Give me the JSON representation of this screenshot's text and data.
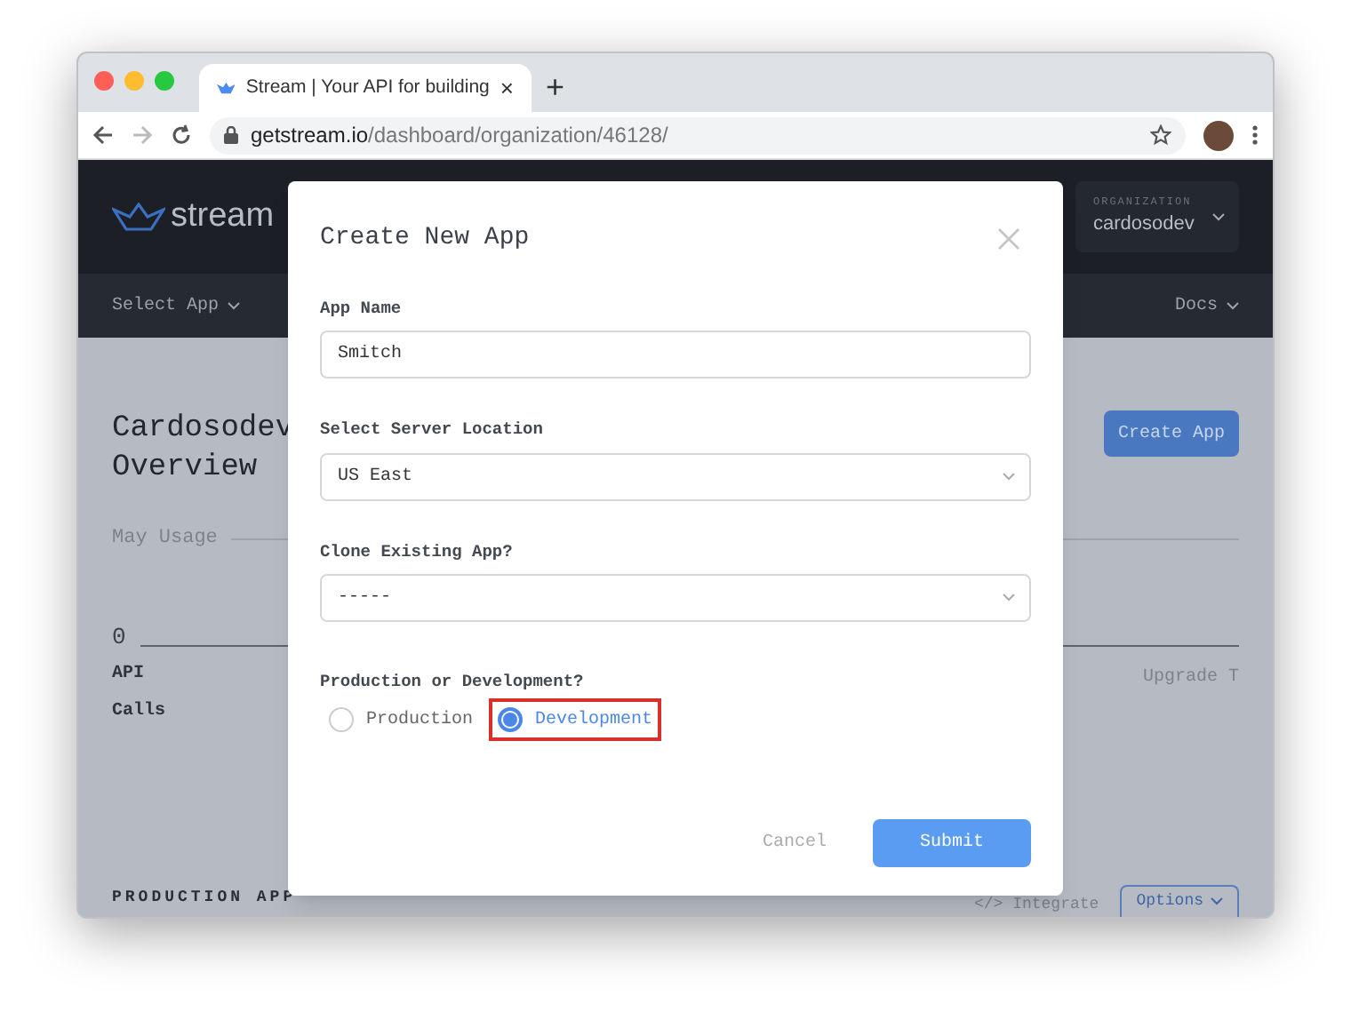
{
  "browser": {
    "tab": {
      "title": "Stream | Your API for building",
      "close": "×"
    },
    "new_tab": "+",
    "url": {
      "host": "getstream.io",
      "path": "/dashboard/organization/46128/"
    }
  },
  "app": {
    "logo": "stream",
    "organization": {
      "label": "ORGANIZATION",
      "name": "cardosodev"
    },
    "nav": [
      {
        "label": "Select App"
      },
      {
        "label": "Docs"
      }
    ],
    "title_lines": [
      "Cardosodev",
      "Overview"
    ],
    "create_button": "Create App",
    "usage": {
      "label": "May Usage",
      "value": "0",
      "unit_lines": [
        "API",
        "Calls"
      ],
      "upgrade": "Upgrade T"
    },
    "section": {
      "title": "PRODUCTION APP",
      "integrate": "</> Integrate",
      "options": "Options"
    }
  },
  "modal": {
    "title": "Create New App",
    "fields": [
      {
        "kind": "text",
        "label": "App Name",
        "value": "Smitch"
      },
      {
        "kind": "select",
        "label": "Select Server Location",
        "value": "US East"
      },
      {
        "kind": "select",
        "label": "Clone Existing App?",
        "value": "-----"
      }
    ],
    "environment": {
      "label": "Production or Development?",
      "options": [
        {
          "label": "Production",
          "selected": false,
          "highlighted": false
        },
        {
          "label": "Development",
          "selected": true,
          "highlighted": true
        }
      ]
    },
    "buttons": [
      {
        "kind": "secondary",
        "label": "Cancel"
      },
      {
        "kind": "primary",
        "label": "Submit"
      }
    ]
  }
}
